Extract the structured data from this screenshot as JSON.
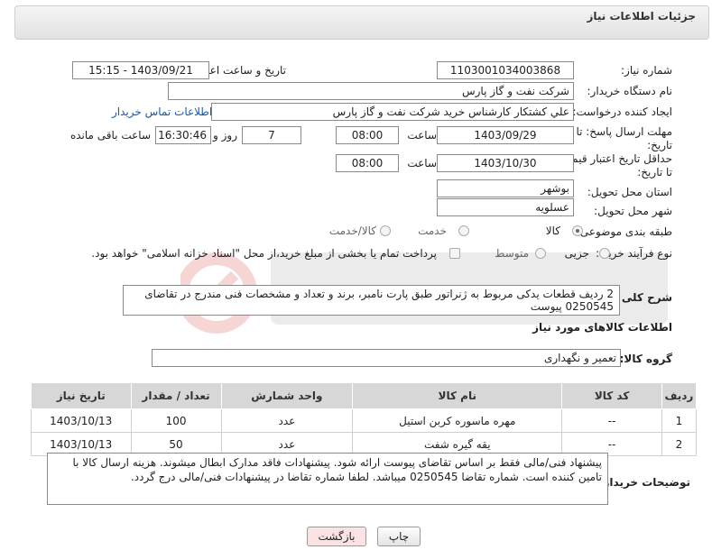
{
  "header": {
    "title": "جزئیات اطلاعات نیاز"
  },
  "form": {
    "need_number_label": "شماره نیاز:",
    "need_number": "1103001034003868",
    "announce_label": "تاریخ و ساعت اعلان عمومی:",
    "announce_value": "1403/09/21 - 15:15",
    "buyer_label": "نام دستگاه خریدار:",
    "buyer_value": "شرکت نفت و گاز پارس",
    "creator_label": "ایجاد کننده درخواست:",
    "creator_value": "علي كشتكار كارشناس خريد شركت نفت و گاز پارس",
    "contact_link": "اطلاعات تماس خریدار",
    "send_deadline_label": "مهلت ارسال پاسخ: تا تاریخ:",
    "send_date": "1403/09/29",
    "time_label": "ساعت",
    "send_time": "08:00",
    "days_value": "7",
    "days_label": "روز و",
    "remaining_time": "16:30:46",
    "remaining_label": "ساعت باقی مانده",
    "validity_label": "حداقل تاریخ اعتبار قیمت: تا تاریخ:",
    "validity_date": "1403/10/30",
    "validity_time_label": "ساعت",
    "validity_time": "08:00",
    "province_label": "استان محل تحویل:",
    "province_value": "بوشهر",
    "city_label": "شهر محل تحویل:",
    "city_value": "عسلویه",
    "category_label": "طبقه بندی موضوعی:",
    "category_options": [
      "کالا",
      "خدمت",
      "کالا/خدمت"
    ],
    "category_selected": "کالا",
    "process_label": "نوع فرآیند خرید :",
    "process_options": [
      "جزیی",
      "متوسط"
    ],
    "payment_note": "پرداخت تمام یا بخشی از مبلغ خرید،از محل \"اسناد خزانه اسلامی\" خواهد بود.",
    "desc_label": "شرح کلی نیاز:",
    "desc_value": "2 ردیف قطعات یدکی مربوط به ژنراتور طبق پارت نامبر، برند و تعداد و مشخصات فنی مندرج در تقاضای 0250545 پیوست"
  },
  "goods": {
    "section_title": "اطلاعات کالاهای مورد نیاز",
    "group_label": "گروه کالا:",
    "group_value": "تعمیر و نگهداری",
    "columns": [
      "ردیف",
      "کد کالا",
      "نام کالا",
      "واحد شمارش",
      "تعداد / مقدار",
      "تاریخ نیاز"
    ],
    "rows": [
      {
        "idx": "1",
        "code": "--",
        "name": "مهره ماسوره کربن استیل",
        "unit": "عدد",
        "qty": "100",
        "date": "1403/10/13"
      },
      {
        "idx": "2",
        "code": "--",
        "name": "یقه گیره شفت",
        "unit": "عدد",
        "qty": "50",
        "date": "1403/10/13"
      }
    ]
  },
  "notes": {
    "label": "توضیحات خریدار:",
    "value": "پیشنهاد فنی/مالی فقط بر اساس تقاضای پیوست ارائه شود. پیشنهادات فاقد مدارک ابطال میشوند. هزینه ارسال کالا با تامین کننده است. شماره تقاضا 0250545  میباشد. لطفا شماره تقاضا در پیشنهادات فنی/مالی درج گردد."
  },
  "buttons": {
    "print": "چاپ",
    "back": "بازگشت"
  },
  "colors": {
    "link": "#1a56a8",
    "back_button_bg": "#fbe3e3",
    "table_header": "#d7d7d7"
  }
}
